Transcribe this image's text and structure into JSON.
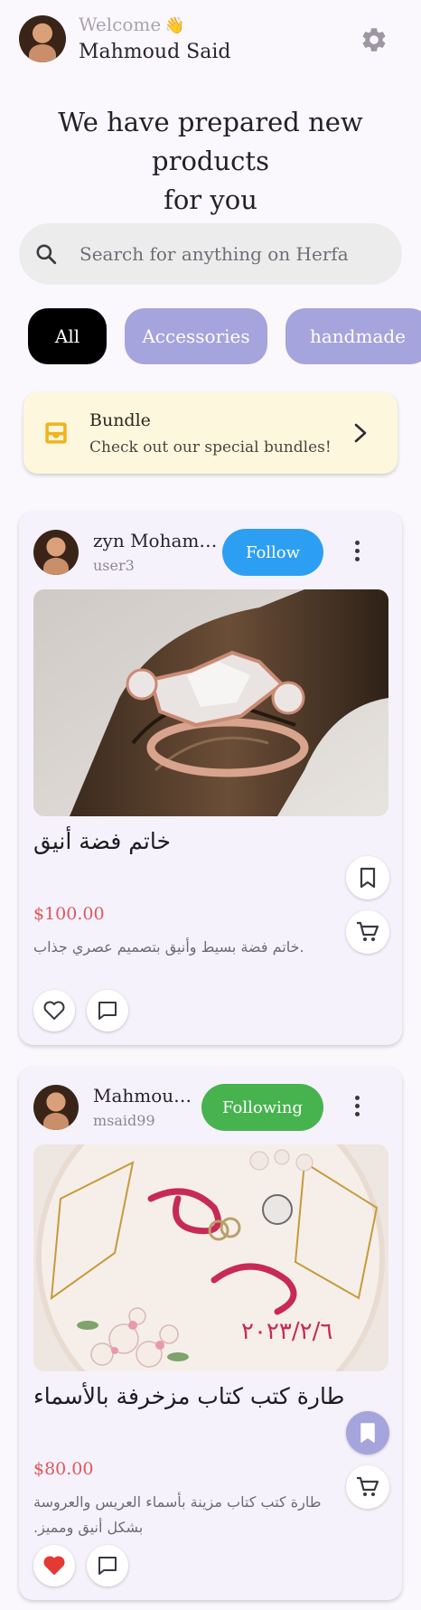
{
  "header": {
    "welcome_label": "Welcome",
    "welcome_emoji": "👋",
    "user_name": "Mahmoud Said",
    "settings_icon": "gear-icon"
  },
  "headline": {
    "line1": "We have prepared new products",
    "line2": "for you"
  },
  "search": {
    "placeholder": "Search for anything on Herfa",
    "icon": "search-icon"
  },
  "categories": [
    {
      "label": "All",
      "selected": true
    },
    {
      "label": "Accessories",
      "selected": false
    },
    {
      "label": "handmade",
      "selected": false
    }
  ],
  "bundle_banner": {
    "title": "Bundle",
    "subtitle": "Check out our special bundles!",
    "icon": "inbox-icon",
    "accent": "#f2b21b",
    "background": "#fdf8dd"
  },
  "posts": [
    {
      "author": "zyn Mohamed",
      "handle": "user3",
      "follow_label": "Follow",
      "follow_color": "#2d9ff3",
      "title": "خاتم فضة أنيق",
      "price": "$100.00",
      "description": "خاتم فضة بسيط وأنيق بتصميم عصري جذاب.",
      "image_subject": "ring-with-raw-crystals",
      "bookmarked": false,
      "liked": false
    },
    {
      "author": "Mahmoud ...",
      "handle": "msaid99",
      "follow_label": "Following",
      "follow_color": "#46b34f",
      "title": "طارة كتب كتاب مزخرفة بالأسماء",
      "price": "$80.00",
      "description": "طارة كتب كتاب مزينة بأسماء العريس والعروسة بشكل أنيق ومميز.",
      "image_subject": "embroidery-hoop-with-names",
      "bookmarked": true,
      "liked": true
    }
  ],
  "colors": {
    "price": "#e0565a",
    "chip_accent": "#a6a4dc",
    "like_active": "#e53935"
  }
}
